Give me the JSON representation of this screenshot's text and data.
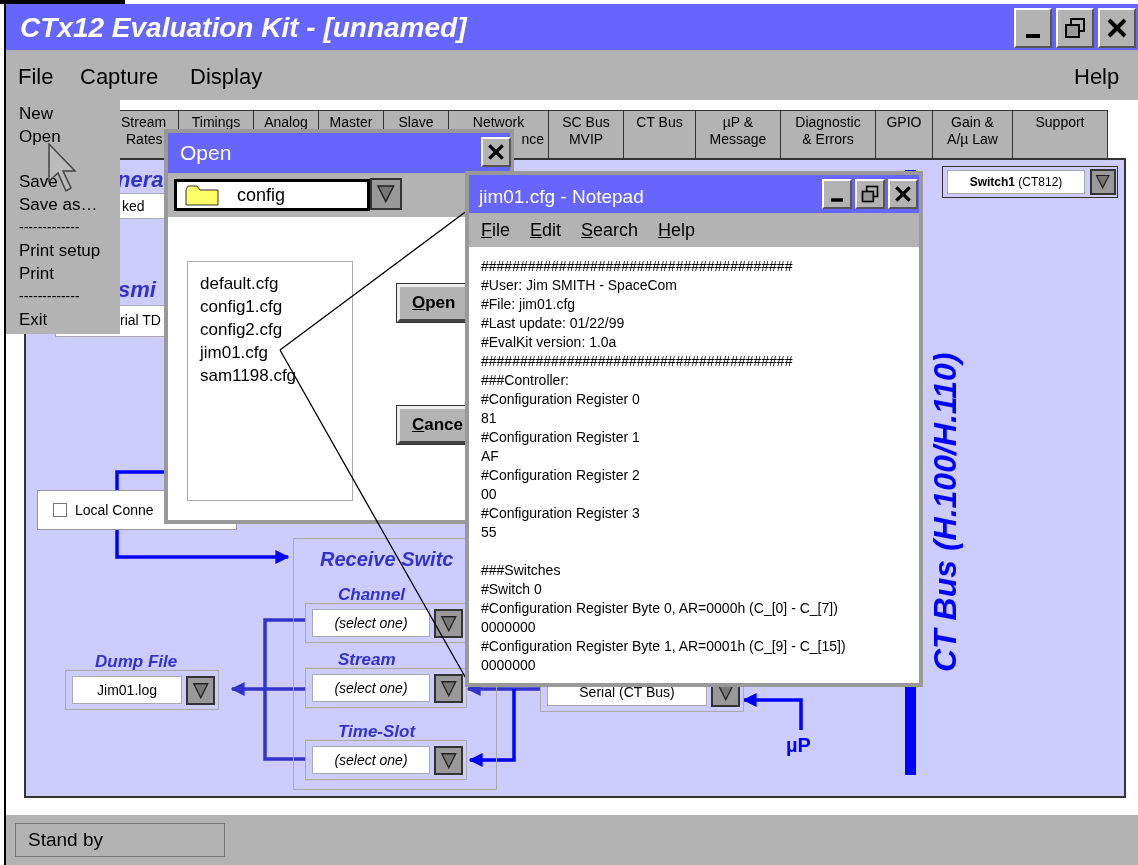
{
  "window": {
    "title": "CTx12 Evaluation Kit - [unnamed]"
  },
  "menu_bar": {
    "items": [
      "File",
      "Capture",
      "Display"
    ],
    "right": [
      "Help"
    ]
  },
  "file_menu": {
    "items": [
      {
        "kind": "item",
        "label": "New"
      },
      {
        "kind": "item",
        "label": "Open"
      },
      {
        "kind": "spacer"
      },
      {
        "kind": "item",
        "label": "Save"
      },
      {
        "kind": "item",
        "label": "Save as…"
      },
      {
        "kind": "separator",
        "label": "-------------"
      },
      {
        "kind": "item",
        "label": "Print setup"
      },
      {
        "kind": "item",
        "label": "Print"
      },
      {
        "kind": "separator",
        "label": "-------------"
      },
      {
        "kind": "item",
        "label": "Exit"
      }
    ]
  },
  "tabs": [
    {
      "lines": [
        "Stream",
        "Rates"
      ]
    },
    {
      "lines": [
        "Timings"
      ]
    },
    {
      "lines": [
        "Analog"
      ]
    },
    {
      "lines": [
        "Master"
      ]
    },
    {
      "lines": [
        "Slave"
      ]
    },
    {
      "lines": [
        "Network",
        "nce"
      ]
    },
    {
      "lines": [
        "SC Bus",
        "MVIP"
      ]
    },
    {
      "lines": [
        "CT Bus"
      ]
    },
    {
      "lines": [
        "µP &",
        "Message"
      ]
    },
    {
      "lines": [
        "Diagnostic",
        "& Errors"
      ]
    },
    {
      "lines": [
        "GPIO"
      ]
    },
    {
      "lines": [
        "Gain &",
        "A/µ Law"
      ]
    },
    {
      "lines": [
        "Support"
      ]
    }
  ],
  "main_panel": {
    "switch_select": "**Switch1** (CT812)",
    "bus_label": "CT Bus (H.100/H.110)",
    "general_title": "nera",
    "general_field": "ked",
    "transmit_title": "smi",
    "transmit_field": "rial TD",
    "local_checkbox": {
      "label": "Local Conne",
      "checked": false
    },
    "receive_switch": {
      "title": "Receive Switc",
      "fields": [
        {
          "label": "Channel",
          "value": "(select one)"
        },
        {
          "label": "Stream",
          "value": "(select one)"
        },
        {
          "label": "Time-Slot",
          "value": "(select one)"
        }
      ]
    },
    "dump_file": {
      "label": "Dump File",
      "value": "Jim01.log"
    },
    "serial_select": "Serial (CT Bus)",
    "processor_label": "µP"
  },
  "open_dialog": {
    "title": "Open",
    "folder": "config",
    "files": [
      "default.cfg",
      "config1.cfg",
      "config2.cfg",
      "jim01.cfg",
      "sam1198.cfg"
    ],
    "buttons": [
      "Open",
      "Cance"
    ]
  },
  "notepad": {
    "title": "jim01.cfg - Notepad",
    "menu": [
      "File",
      "Edit",
      "Search",
      "Help"
    ],
    "paragraphs": [
      [
        "########################################",
        "#User: Jim SMITH - SpaceCom",
        "#File: jim01.cfg",
        "#Last update: 01/22/99",
        "#EvalKit version: 1.0a",
        "########################################",
        "###Controller:",
        "#Configuration Register 0",
        "81",
        "#Configuration Register 1",
        "AF",
        "#Configuration Register 2",
        "00",
        "#Configuration Register 3",
        "55"
      ],
      [
        "###Switches",
        "#Switch 0",
        "#Configuration Register Byte 0, AR=0000h (C_[0] - C_[7])",
        "0000000",
        "#Configuration Register Byte 1, AR=0001h (C_[9] - C_[15])",
        "0000000"
      ]
    ]
  },
  "status_bar": {
    "text": "Stand by"
  }
}
